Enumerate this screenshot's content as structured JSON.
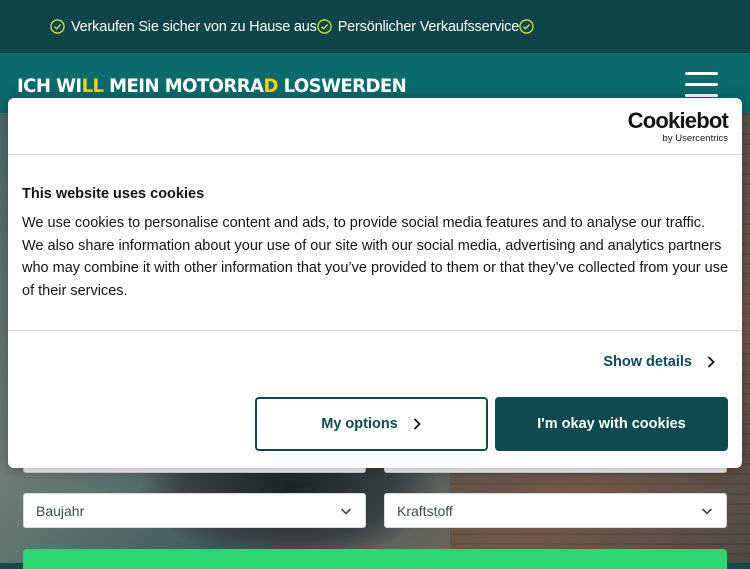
{
  "topbar": {
    "benefits": [
      "Verkaufen Sie sicher von zu Hause aus",
      "Persönlicher Verkaufsservice",
      ""
    ]
  },
  "header": {
    "logo_part1": "ICH WI",
    "logo_highlight": "LL",
    "logo_part2": " MEIN MOTORRA",
    "logo_highlight2": "D",
    "logo_part3": " LOSWERDEN"
  },
  "form": {
    "year_placeholder": "Baujahr",
    "fuel_placeholder": "Kraftstoff"
  },
  "cookie_banner": {
    "brand_name": "Cookiebot",
    "brand_sub": "by Usercentrics",
    "title": "This website uses cookies",
    "body": "We use cookies to personalise content and ads, to provide social media features and to analyse our traffic. We also share information about your use of our site with our social media, advertising and analytics partners who may combine it with other information that you’ve provided to them or that they’ve collected from your use of their services.",
    "show_details": "Show details",
    "options_button": "My options",
    "accept_button": "I'm okay with cookies"
  },
  "colors": {
    "brand_dark": "#0f4a4f",
    "header_teal": "#0c6a6b",
    "logo_accent": "#f2d21c",
    "check_green": "#c6e34a",
    "cta_green": "#2ed573"
  }
}
